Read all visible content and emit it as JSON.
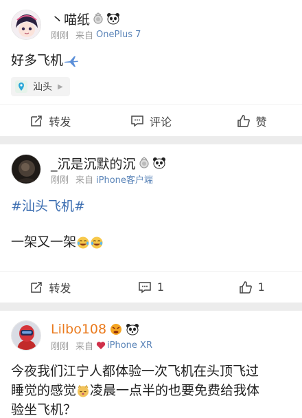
{
  "posts": [
    {
      "username": "丶喵纸",
      "time": "刚刚",
      "from_label": "来自",
      "device": "OnePlus 7",
      "text": "好多飞机",
      "location": "汕头",
      "repost_label": "转发",
      "comment_label": "评论",
      "like_label": "赞"
    },
    {
      "username": "_沉是沉默的沉",
      "time": "刚刚",
      "from_label": "来自",
      "device": "iPhone客户端",
      "topic": "#汕头飞机#",
      "text": "一架又一架",
      "repost_label": "转发",
      "comment_count": "1",
      "like_count": "1"
    },
    {
      "username": "Lilbo108",
      "time": "刚刚",
      "from_label": "来自",
      "device": "iPhone XR",
      "text_line1": "今夜我们江宁人都体验一次飞机在头顶飞过",
      "text_line2a": "睡觉的感觉",
      "text_line2b": "凌晨一点半的也要免费给我体",
      "text_line3": "验坐飞机？"
    }
  ],
  "colors": {
    "orange_username": "#ea7a1d",
    "link_blue": "#5a84b8",
    "topic_blue": "#3a6cb0",
    "separator": "#ececec"
  }
}
